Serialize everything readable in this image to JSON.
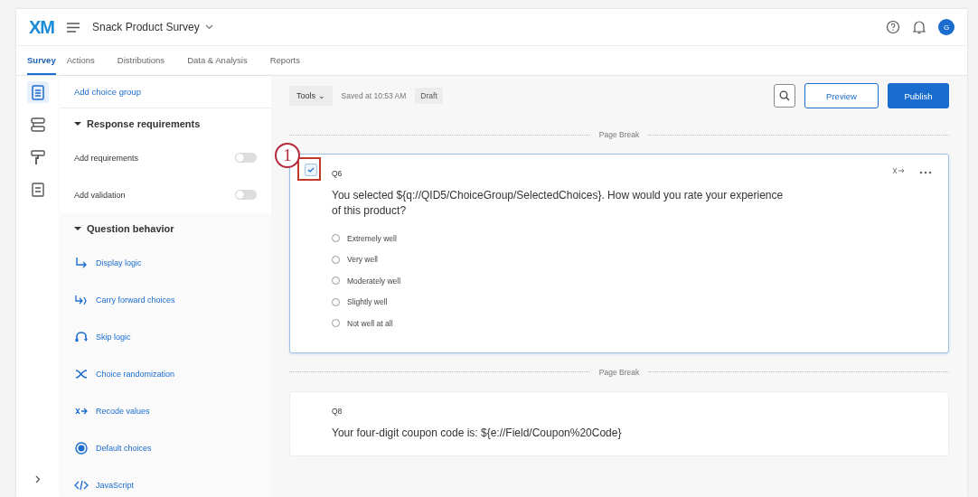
{
  "header": {
    "logo": "XM",
    "survey_title": "Snack Product Survey",
    "avatar": "G"
  },
  "tabs": [
    {
      "label": "Survey",
      "selected": true
    },
    {
      "label": "Actions",
      "selected": false
    },
    {
      "label": "Distributions",
      "selected": false
    },
    {
      "label": "Data & Analysis",
      "selected": false
    },
    {
      "label": "Reports",
      "selected": false
    }
  ],
  "rail": [
    {
      "kind": "survey",
      "selected": true
    },
    {
      "kind": "flow",
      "selected": false
    },
    {
      "kind": "style",
      "selected": false
    },
    {
      "kind": "options",
      "selected": false
    }
  ],
  "panel": {
    "top_link": "Add choice group",
    "sections": [
      {
        "title": "Response requirements",
        "expanded": true,
        "items": [
          {
            "kind": "toggle",
            "label": "Add requirements",
            "on": false
          },
          {
            "kind": "toggle",
            "label": "Add validation",
            "on": false
          }
        ]
      },
      {
        "title": "Question behavior",
        "expanded": true,
        "items": [
          {
            "kind": "display",
            "label": "Display logic"
          },
          {
            "kind": "carry",
            "label": "Carry forward choices"
          },
          {
            "kind": "skip",
            "label": "Skip logic"
          },
          {
            "kind": "random",
            "label": "Choice randomization"
          },
          {
            "kind": "recode",
            "label": "Recode values"
          },
          {
            "kind": "default",
            "label": "Default choices"
          },
          {
            "kind": "code",
            "label": "JavaScript"
          }
        ]
      }
    ]
  },
  "toolbar": {
    "tools": "Tools",
    "tools_caret": "⌄",
    "saved": "Saved at 10:53 AM",
    "status": "Draft",
    "preview": "Preview",
    "publish": "Publish"
  },
  "questions": [
    {
      "page_break": "Page Break",
      "id": "Q6",
      "selected": true,
      "callout": "1",
      "text": "You selected ${q://QID5/ChoiceGroup/SelectedChoices}. How would you rate your experience of this product?",
      "choices": [
        {
          "label": "Extremely well",
          "selected": false
        },
        {
          "label": "Very well",
          "selected": false
        },
        {
          "label": "Moderately well",
          "selected": false
        },
        {
          "label": "Slightly well",
          "selected": false
        },
        {
          "label": "Not well at all",
          "selected": false
        }
      ]
    },
    {
      "page_break": "Page Break",
      "id": "Q8",
      "selected": false,
      "text": "Your four-digit coupon code is: ${e://Field/Coupon%20Code}"
    }
  ]
}
